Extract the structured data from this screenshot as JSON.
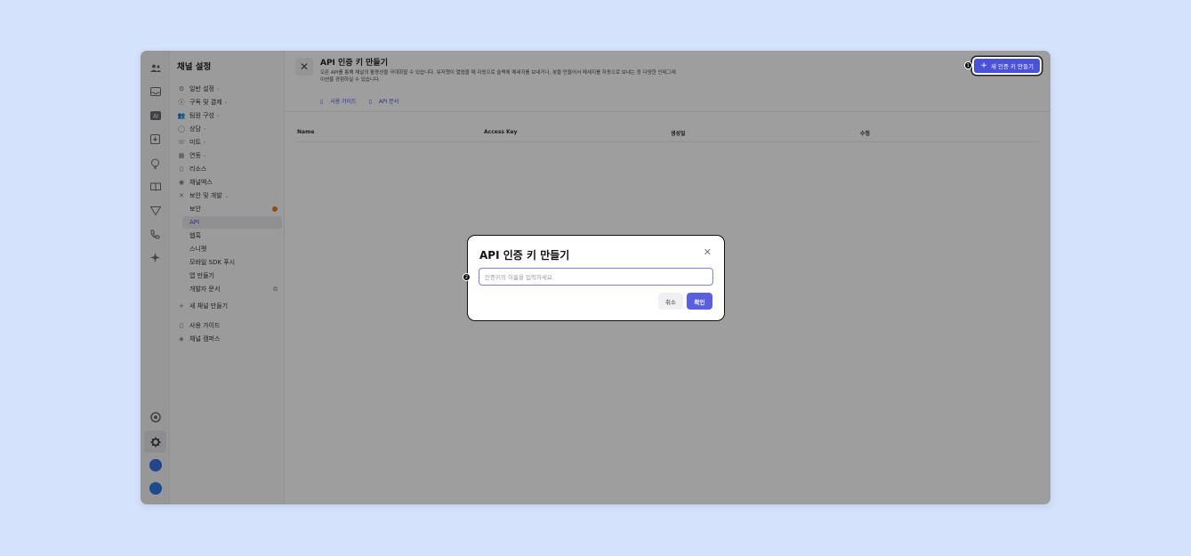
{
  "sidebar": {
    "title": "채널 설정",
    "items": [
      {
        "icon": "gear-icon",
        "label": "일반 설정",
        "chevron": "›"
      },
      {
        "icon": "dollar-circle-icon",
        "label": "구독 및 결제",
        "chevron": "›"
      },
      {
        "icon": "team-icon",
        "label": "팀원 구성",
        "chevron": "›"
      },
      {
        "icon": "chat-bubble-icon",
        "label": "상담",
        "chevron": "›"
      },
      {
        "icon": "phone-icon",
        "label": "미트",
        "chevron": "›"
      },
      {
        "icon": "grid-icon",
        "label": "연동",
        "chevron": "›"
      },
      {
        "icon": "book-icon",
        "label": "리소스",
        "chevron": ""
      },
      {
        "icon": "channel-x-icon",
        "label": "채널엑스",
        "chevron": ""
      },
      {
        "icon": "tools-icon",
        "label": "보안 및 개발",
        "chevron": "⌄"
      }
    ],
    "sub_items": [
      {
        "label": "보안"
      },
      {
        "label": "API"
      },
      {
        "label": "웹훅"
      },
      {
        "label": "스니펫"
      },
      {
        "label": "모바일 SDK 푸시"
      },
      {
        "label": "앱 만들기"
      },
      {
        "label": "개발자 문서"
      }
    ],
    "new_channel": "새 채널 만들기",
    "guide": "사용 가이드",
    "campus": "채널 캠퍼스"
  },
  "header": {
    "title": "API 인증 키 만들기",
    "description": "오픈 API를 통해 채널의 활용성을 극대화할 수 있습니다. 유저챗이 열렸을 때 자동으로 슬랙에 메세지를 보내거나, 봇을 만들어서 메세지를 자동으로 보내는 등 다양한 인테그레이션을 경험하실 수 있습니다.",
    "link_guide": "사용 가이드",
    "link_docs": "API 문서",
    "create_button": "새 인증 키 만들기"
  },
  "table": {
    "columns": [
      "Name",
      "Access Key",
      "생성일",
      "수정"
    ]
  },
  "modal": {
    "title": "API 인증 키 만들기",
    "input_placeholder": "인증키의 이름을 입력하세요.",
    "cancel": "취소",
    "confirm": "확인"
  },
  "markers": {
    "one": "1",
    "two": "2"
  },
  "colors": {
    "accent": "#4a52d6",
    "warning": "#e97a1f",
    "background": "#d4e2fb"
  }
}
